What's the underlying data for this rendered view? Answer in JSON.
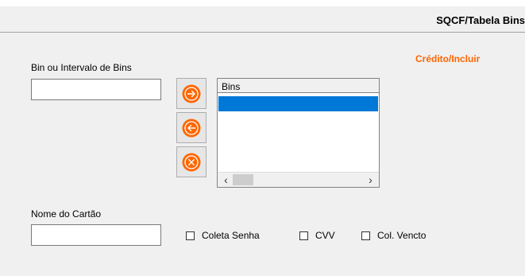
{
  "header": {
    "title": "SQCF/Tabela Bins"
  },
  "mode_label": "Crédito/Incluir",
  "bin_field": {
    "label": "Bin ou Intervalo de Bins",
    "value": ""
  },
  "buttons": {
    "add_icon": "arrow-right-circle-icon",
    "remove_icon": "arrow-left-circle-icon",
    "clear_icon": "x-circle-icon",
    "accent_color": "#ff6600"
  },
  "bins_list": {
    "header": "Bins",
    "selected_color": "#0078d7",
    "items": []
  },
  "card_field": {
    "label": "Nome do Cartão",
    "value": ""
  },
  "checkboxes": [
    {
      "label": "Coleta Senha",
      "checked": false
    },
    {
      "label": "CVV",
      "checked": false
    },
    {
      "label": "Col. Vencto",
      "checked": false
    }
  ]
}
